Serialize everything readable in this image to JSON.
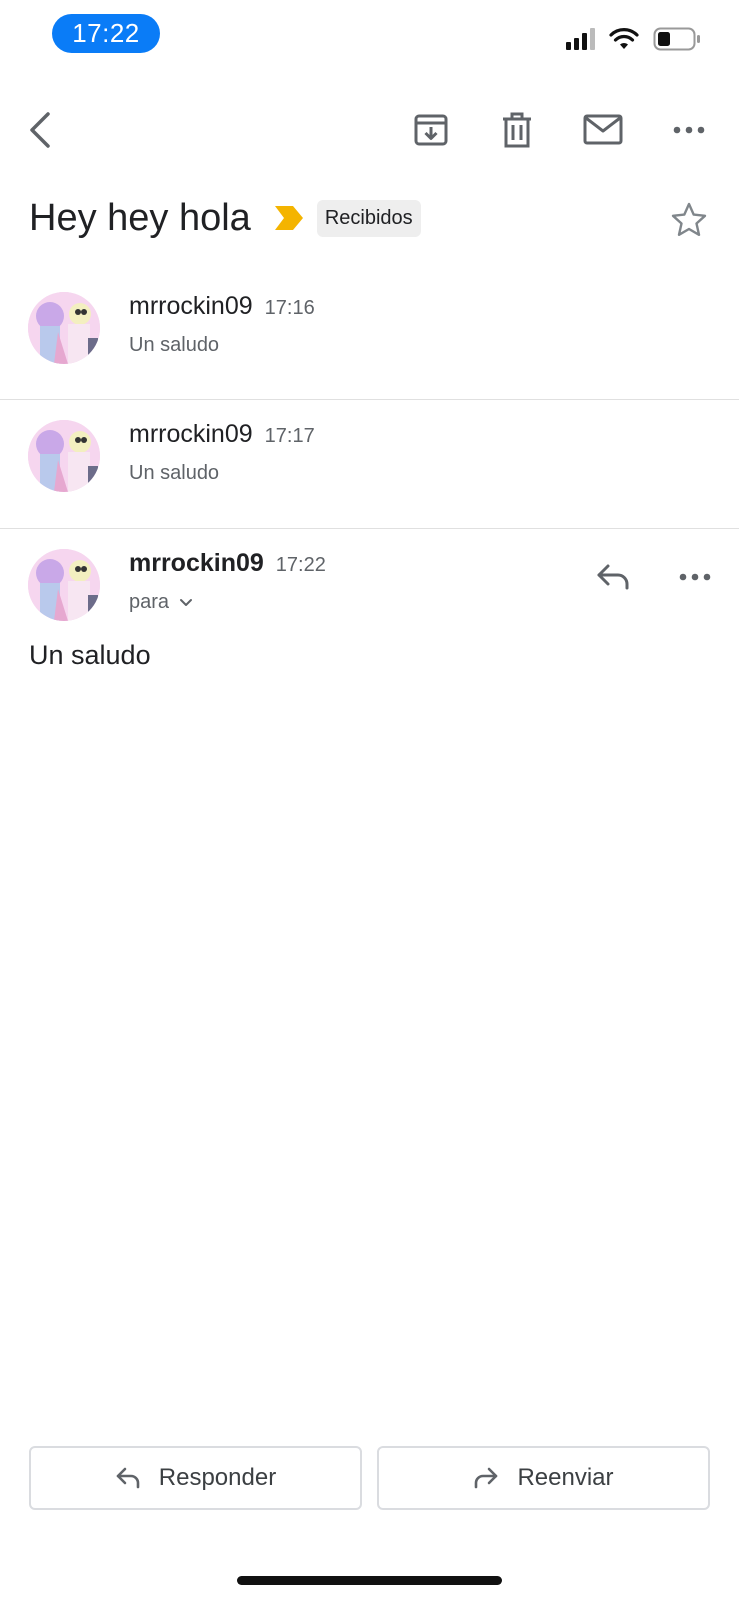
{
  "status_bar": {
    "time": "17:22"
  },
  "toolbar": {
    "back": "chevron-left-icon",
    "archive": "archive-icon",
    "delete": "trash-icon",
    "mark_unread": "mail-icon",
    "more": "more-horizontal-icon"
  },
  "thread": {
    "subject": "Hey hey hola",
    "importance_color": "#f4b400",
    "label": "Recibidos",
    "starred": false
  },
  "messages": [
    {
      "sender": "mrrockin09",
      "time": "17:16",
      "snippet": "Un saludo"
    },
    {
      "sender": "mrrockin09",
      "time": "17:17",
      "snippet": "Un saludo"
    },
    {
      "sender": "mrrockin09",
      "time": "17:22",
      "recipient_label": "para",
      "body": "Un saludo"
    }
  ],
  "actions": {
    "reply": "Responder",
    "forward": "Reenviar"
  },
  "colors": {
    "accent": "#0a7cf7",
    "divider": "#e0e0e0",
    "secondary_text": "#5f6368"
  }
}
